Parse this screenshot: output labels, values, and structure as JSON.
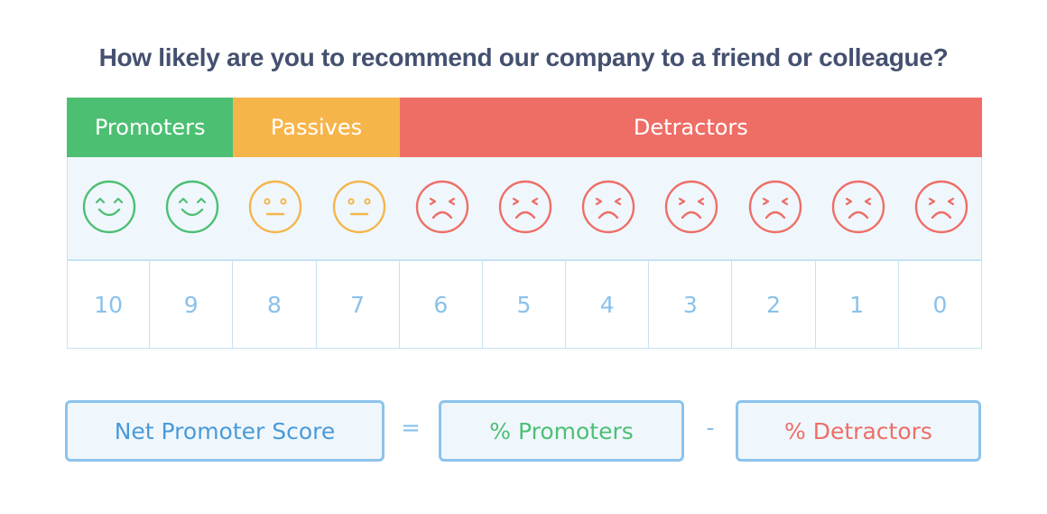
{
  "title": "How likely are you to recommend our company to a friend or colleague?",
  "categories": [
    {
      "label": "Promoters",
      "color": "#4dbf73",
      "span": 2,
      "face": "happy"
    },
    {
      "label": "Passives",
      "color": "#f6b54b",
      "span": 2,
      "face": "neutral"
    },
    {
      "label": "Detractors",
      "color": "#ee6e66",
      "span": 7,
      "face": "sad"
    }
  ],
  "scores": [
    "10",
    "9",
    "8",
    "7",
    "6",
    "5",
    "4",
    "3",
    "2",
    "1",
    "0"
  ],
  "faces": [
    {
      "type": "happy-face",
      "color": "#4dbf73"
    },
    {
      "type": "happy-face",
      "color": "#4dbf73"
    },
    {
      "type": "neutral-face",
      "color": "#f6b54b"
    },
    {
      "type": "neutral-face",
      "color": "#f6b54b"
    },
    {
      "type": "sad-face",
      "color": "#ee6e66"
    },
    {
      "type": "sad-face",
      "color": "#ee6e66"
    },
    {
      "type": "sad-face",
      "color": "#ee6e66"
    },
    {
      "type": "sad-face",
      "color": "#ee6e66"
    },
    {
      "type": "sad-face",
      "color": "#ee6e66"
    },
    {
      "type": "sad-face",
      "color": "#ee6e66"
    },
    {
      "type": "sad-face",
      "color": "#ee6e66"
    }
  ],
  "formula": {
    "result": {
      "label": "Net Promoter Score",
      "color": "#4a9ad8"
    },
    "equals": "=",
    "term1": {
      "label": "% Promoters",
      "color": "#4dbf73"
    },
    "minus": "-",
    "term2": {
      "label": "% Detractors",
      "color": "#ee6e66"
    }
  }
}
